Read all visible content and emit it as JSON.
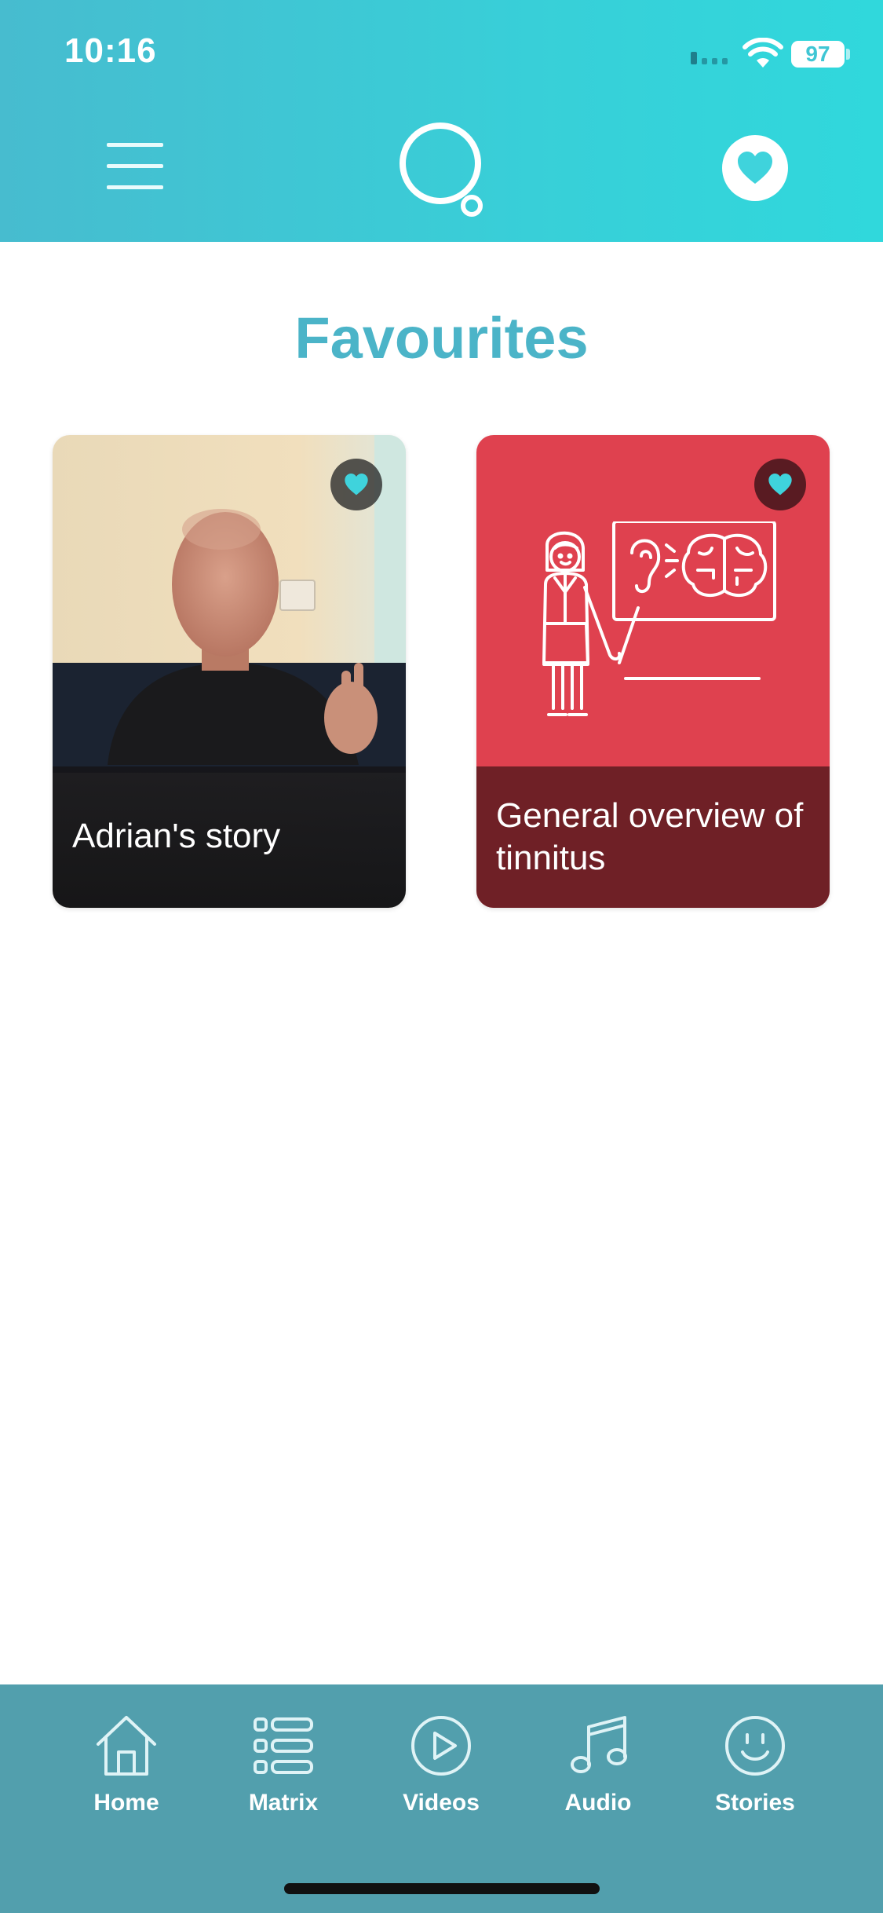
{
  "status_bar": {
    "time": "10:16",
    "battery": "97"
  },
  "header": {
    "menu_icon": "hamburger-menu-icon",
    "logo_icon": "thought-bubble-logo",
    "favourites_icon": "heart-icon"
  },
  "page": {
    "title": "Favourites"
  },
  "cards": [
    {
      "title": "Adrian's story",
      "type": "video",
      "favourited": true
    },
    {
      "title": "General overview of tinnitus",
      "type": "illustration",
      "favourited": true
    }
  ],
  "bottom_nav": [
    {
      "label": "Home",
      "icon": "home-icon"
    },
    {
      "label": "Matrix",
      "icon": "list-icon"
    },
    {
      "label": "Videos",
      "icon": "play-icon"
    },
    {
      "label": "Audio",
      "icon": "music-note-icon"
    },
    {
      "label": "Stories",
      "icon": "smiley-face-icon"
    }
  ],
  "colors": {
    "header_start": "#47bccf",
    "header_end": "#30d8dc",
    "title": "#4bb4c8",
    "card_red": "#df414f",
    "nav_bar": "#529fad",
    "heart_accent": "#3fd3dc"
  }
}
